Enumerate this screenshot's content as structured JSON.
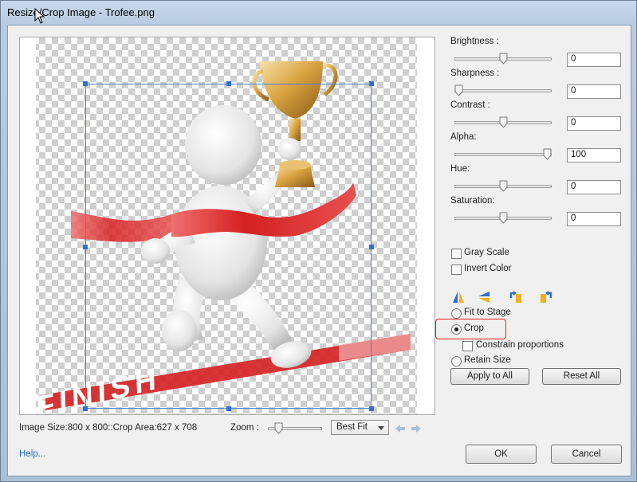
{
  "window": {
    "title": "Resize/Crop Image - Trofee.png"
  },
  "image": {
    "ribbon_text": "FINISH"
  },
  "adjustments": [
    {
      "label": "Brightness :",
      "value": "0",
      "level": 0.5
    },
    {
      "label": "Sharpness :",
      "value": "0",
      "level": 0.0
    },
    {
      "label": "Contrast :",
      "value": "0",
      "level": 0.5
    },
    {
      "label": "Alpha:",
      "value": "100",
      "level": 1.0
    },
    {
      "label": "Hue:",
      "value": "0",
      "level": 0.5
    },
    {
      "label": "Saturation:",
      "value": "0",
      "level": 0.5
    }
  ],
  "checkboxes": {
    "gray_scale": "Gray Scale",
    "invert_color": "Invert Color",
    "constrain": "Constrain proportions"
  },
  "radios": {
    "fit_to_stage": "Fit to Stage",
    "crop": "Crop",
    "retain_size": "Retain Size",
    "selected": "Crop"
  },
  "icons": [
    "flip-horizontal-icon",
    "flip-vertical-icon",
    "rotate-left-icon",
    "rotate-right-icon"
  ],
  "buttons": {
    "apply_all": "Apply to All",
    "reset_all": "Reset All",
    "ok": "OK",
    "cancel": "Cancel"
  },
  "status": {
    "text": "Image Size:800 x 800::Crop Area:627 x 708"
  },
  "zoom": {
    "label": "Zoom :",
    "value": "Best Fit",
    "level": 0.15
  },
  "help": {
    "label": "Help..."
  },
  "colors": {
    "highlight": "#e02020",
    "accent": "#2f6fd8",
    "ribbon": "#d42020"
  }
}
